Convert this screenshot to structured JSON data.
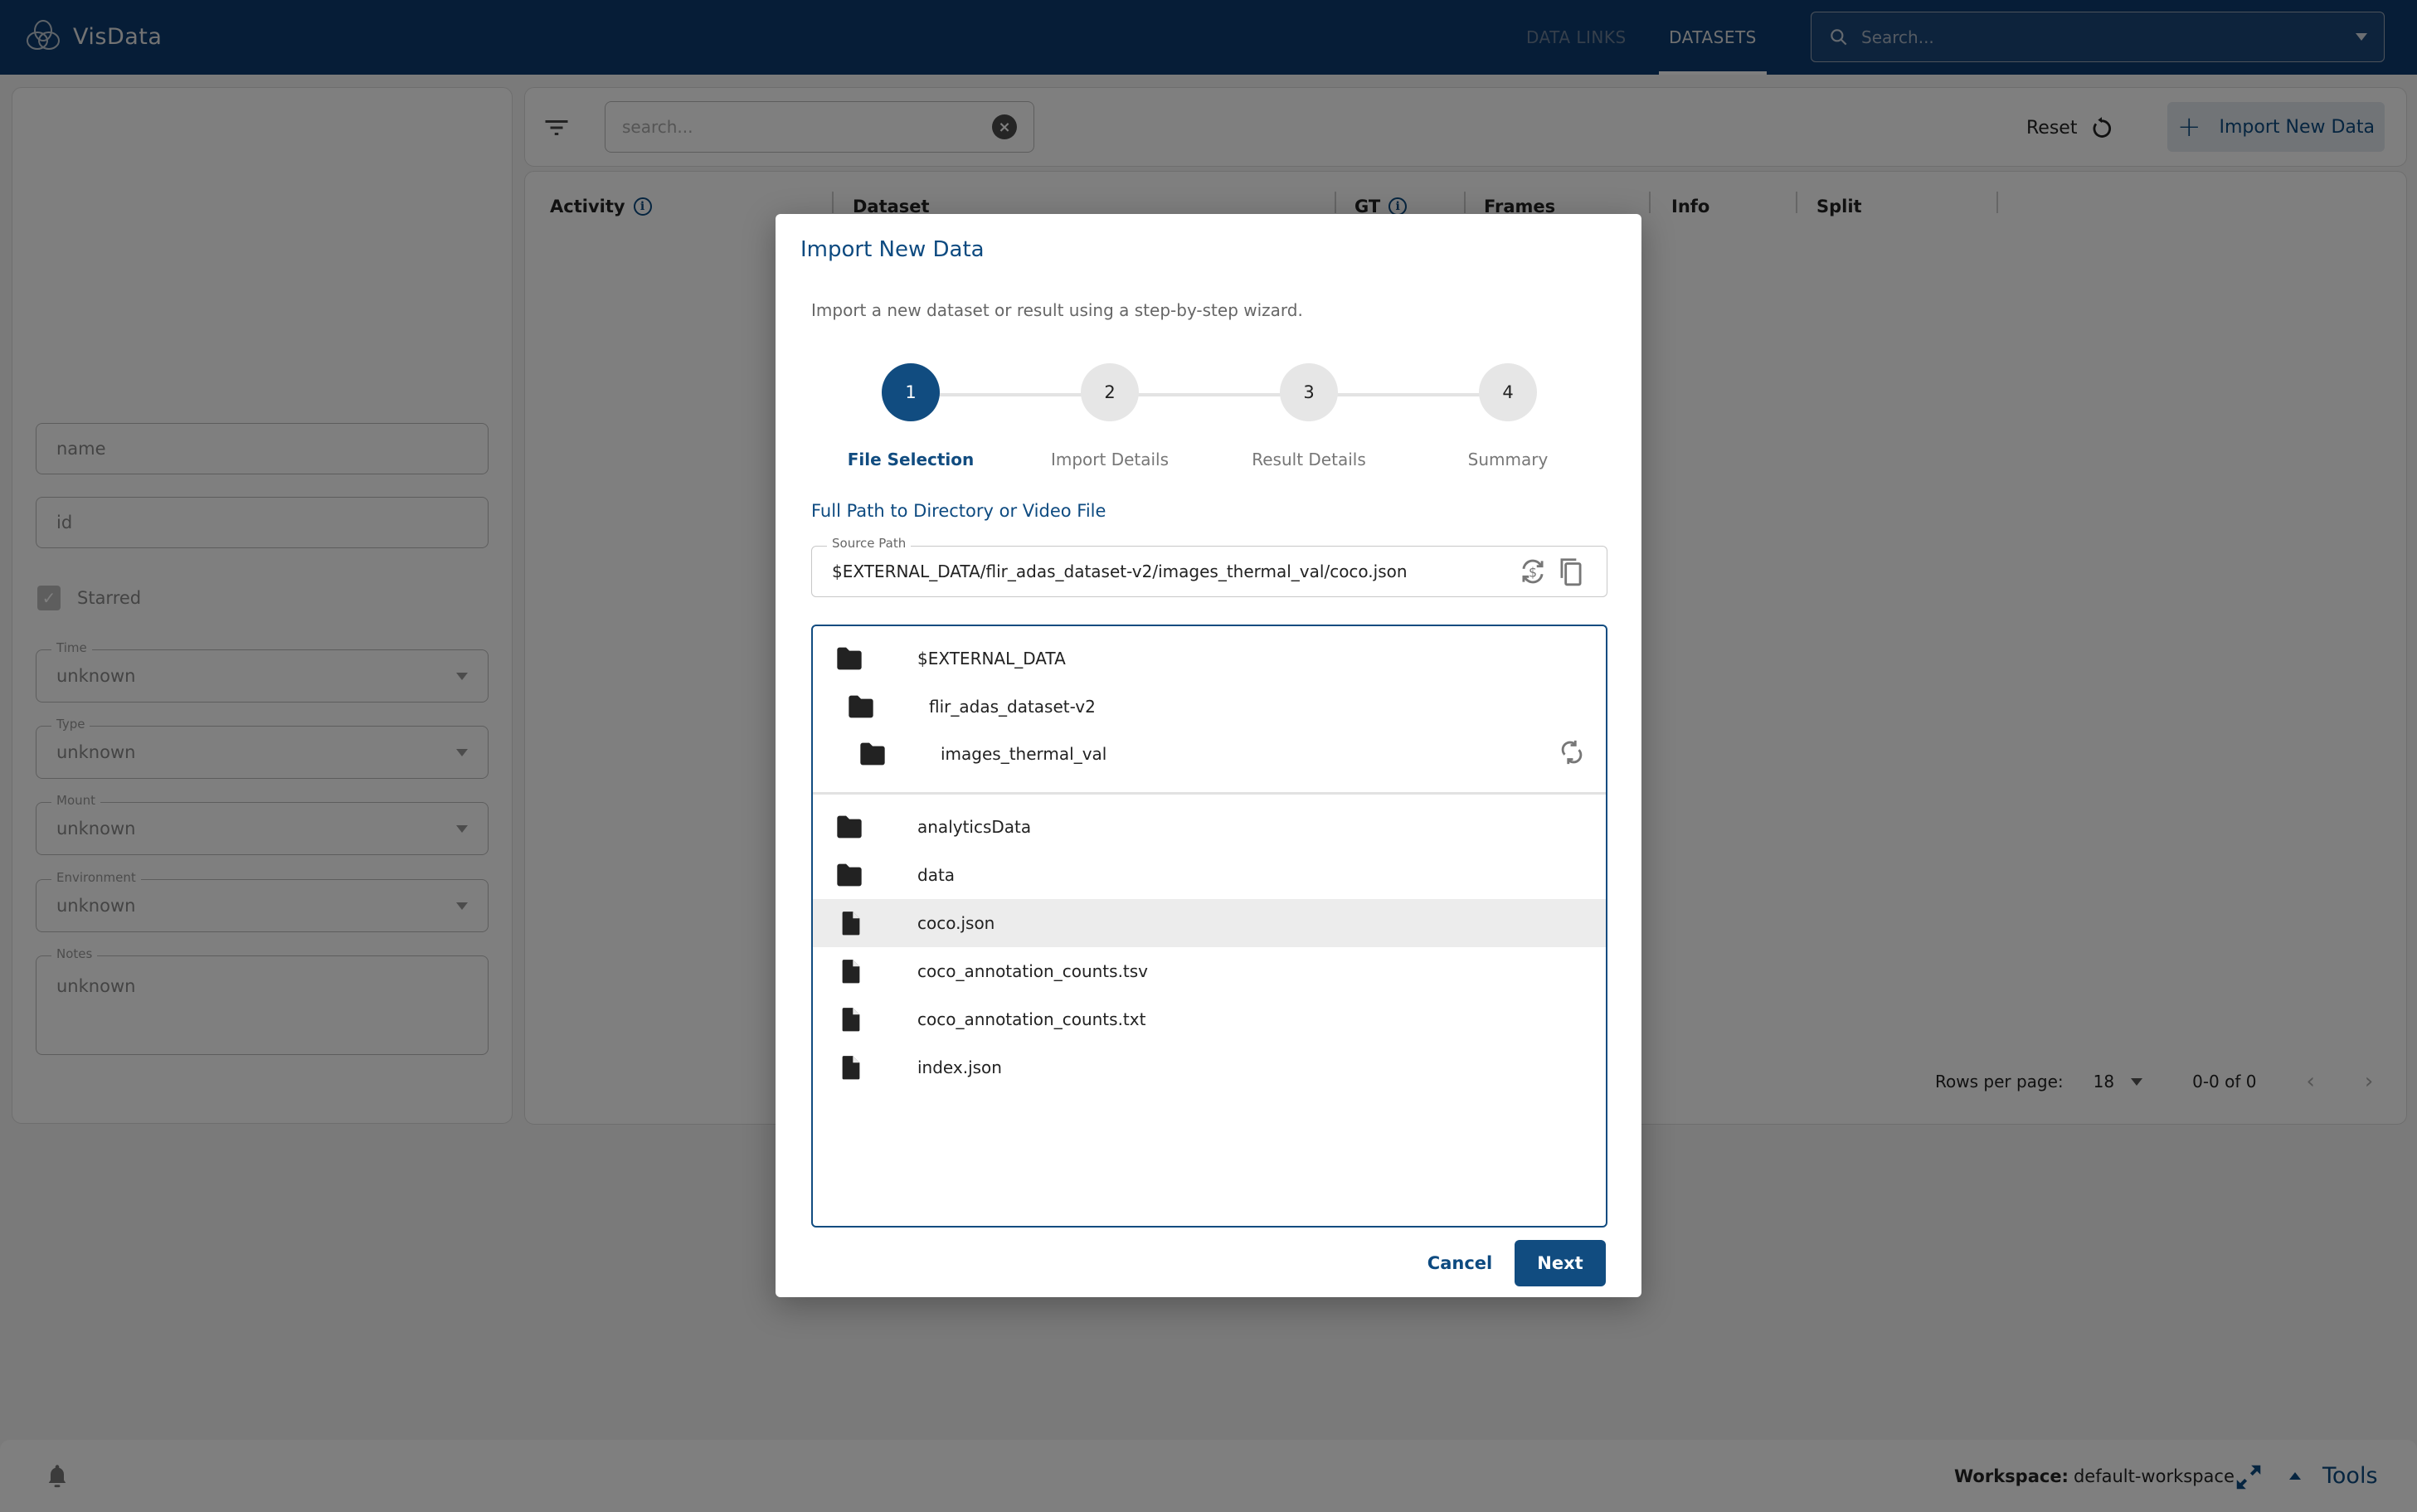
{
  "app": {
    "name": "VisData",
    "nav": [
      {
        "label": "DATA LINKS",
        "active": false
      },
      {
        "label": "DATASETS",
        "active": true
      }
    ],
    "search_placeholder": "Search..."
  },
  "filters": {
    "name_placeholder": "name",
    "id_placeholder": "id",
    "starred_label": "Starred",
    "starred_checked": true,
    "selects": [
      {
        "label": "Time",
        "value": "unknown"
      },
      {
        "label": "Type",
        "value": "unknown"
      },
      {
        "label": "Mount",
        "value": "unknown"
      },
      {
        "label": "Environment",
        "value": "unknown"
      }
    ],
    "notes": {
      "label": "Notes",
      "value": "unknown"
    }
  },
  "toolbar": {
    "search_placeholder": "search...",
    "reset_label": "Reset",
    "import_label": "Import New Data"
  },
  "table": {
    "columns": [
      "Activity",
      "Dataset",
      "GT",
      "Frames",
      "Info",
      "Split"
    ],
    "rows": [],
    "pagination": {
      "rows_per_page_label": "Rows per page:",
      "rows_per_page": "18",
      "range": "0-0 of 0",
      "prev": "‹",
      "next": "›"
    }
  },
  "bottom_bar": {
    "workspace_label": "Workspace:",
    "workspace_value": "default-workspace",
    "tools_label": "Tools"
  },
  "modal": {
    "title": "Import New Data",
    "description": "Import a new dataset or result using a step-by-step wizard.",
    "steps": [
      {
        "number": "1",
        "label": "File Selection",
        "active": true
      },
      {
        "number": "2",
        "label": "Import Details",
        "active": false
      },
      {
        "number": "3",
        "label": "Result Details",
        "active": false
      },
      {
        "number": "4",
        "label": "Summary",
        "active": false
      }
    ],
    "section_label": "Full Path to Directory or Video File",
    "source_path_label": "Source Path",
    "source_path_value": "$EXTERNAL_DATA/flir_adas_dataset-v2/images_thermal_val/coco.json",
    "breadcrumb": [
      {
        "name": "$EXTERNAL_DATA",
        "type": "folder"
      },
      {
        "name": "flir_adas_dataset-v2",
        "type": "folder"
      },
      {
        "name": "images_thermal_val",
        "type": "folder"
      }
    ],
    "entries": [
      {
        "name": "analyticsData",
        "type": "folder",
        "selected": false
      },
      {
        "name": "data",
        "type": "folder",
        "selected": false
      },
      {
        "name": "coco.json",
        "type": "file",
        "selected": true
      },
      {
        "name": "coco_annotation_counts.tsv",
        "type": "file",
        "selected": false
      },
      {
        "name": "coco_annotation_counts.txt",
        "type": "file",
        "selected": false
      },
      {
        "name": "index.json",
        "type": "file",
        "selected": false
      }
    ],
    "cancel_label": "Cancel",
    "next_label": "Next"
  }
}
